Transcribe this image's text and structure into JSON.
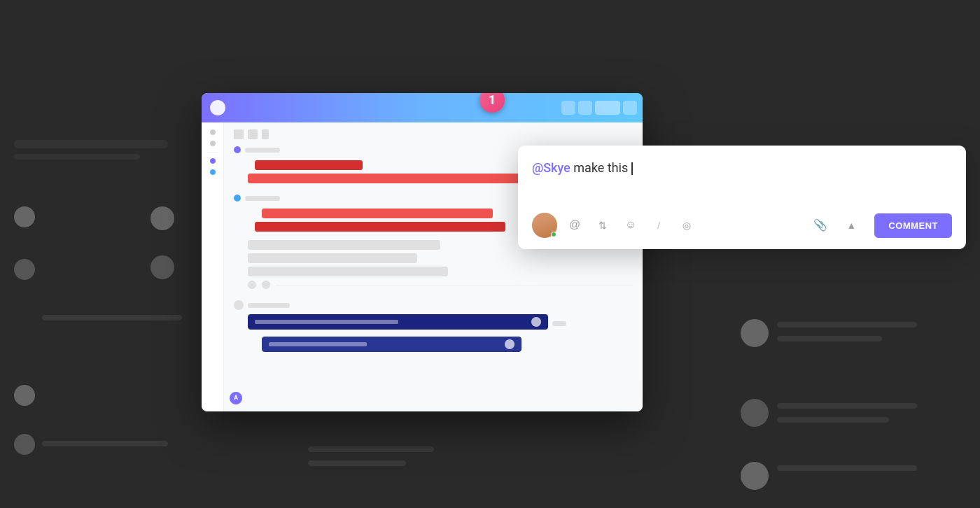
{
  "background": {
    "color": "#2a2a2a"
  },
  "notification_badge": {
    "number": "1",
    "color": "#ec407a"
  },
  "app_card": {
    "header": {
      "gradient_start": "#7c6fff",
      "gradient_end": "#60c8ff"
    },
    "task_sections": {
      "red_bars": [
        {
          "width": "35%",
          "color": "red-dark"
        },
        {
          "width": "75%",
          "color": "red-medium"
        },
        {
          "width": "60%",
          "color": "red-medium"
        },
        {
          "width": "65%",
          "color": "red-dark"
        }
      ],
      "gray_bars": [
        {
          "width": "50%"
        },
        {
          "width": "45%"
        },
        {
          "width": "55%"
        }
      ],
      "blue_bars": [
        {
          "width": "80%"
        },
        {
          "width": "68%"
        }
      ]
    },
    "bottom_avatar_label": "A"
  },
  "comment_popup": {
    "mention": "@Skye",
    "text": " make this ",
    "cursor": "|",
    "toolbar_icons": [
      "@",
      "↕",
      "☺",
      "/",
      "◎"
    ],
    "submit_button": "COMMENT",
    "submit_color": "#7c6fff"
  }
}
